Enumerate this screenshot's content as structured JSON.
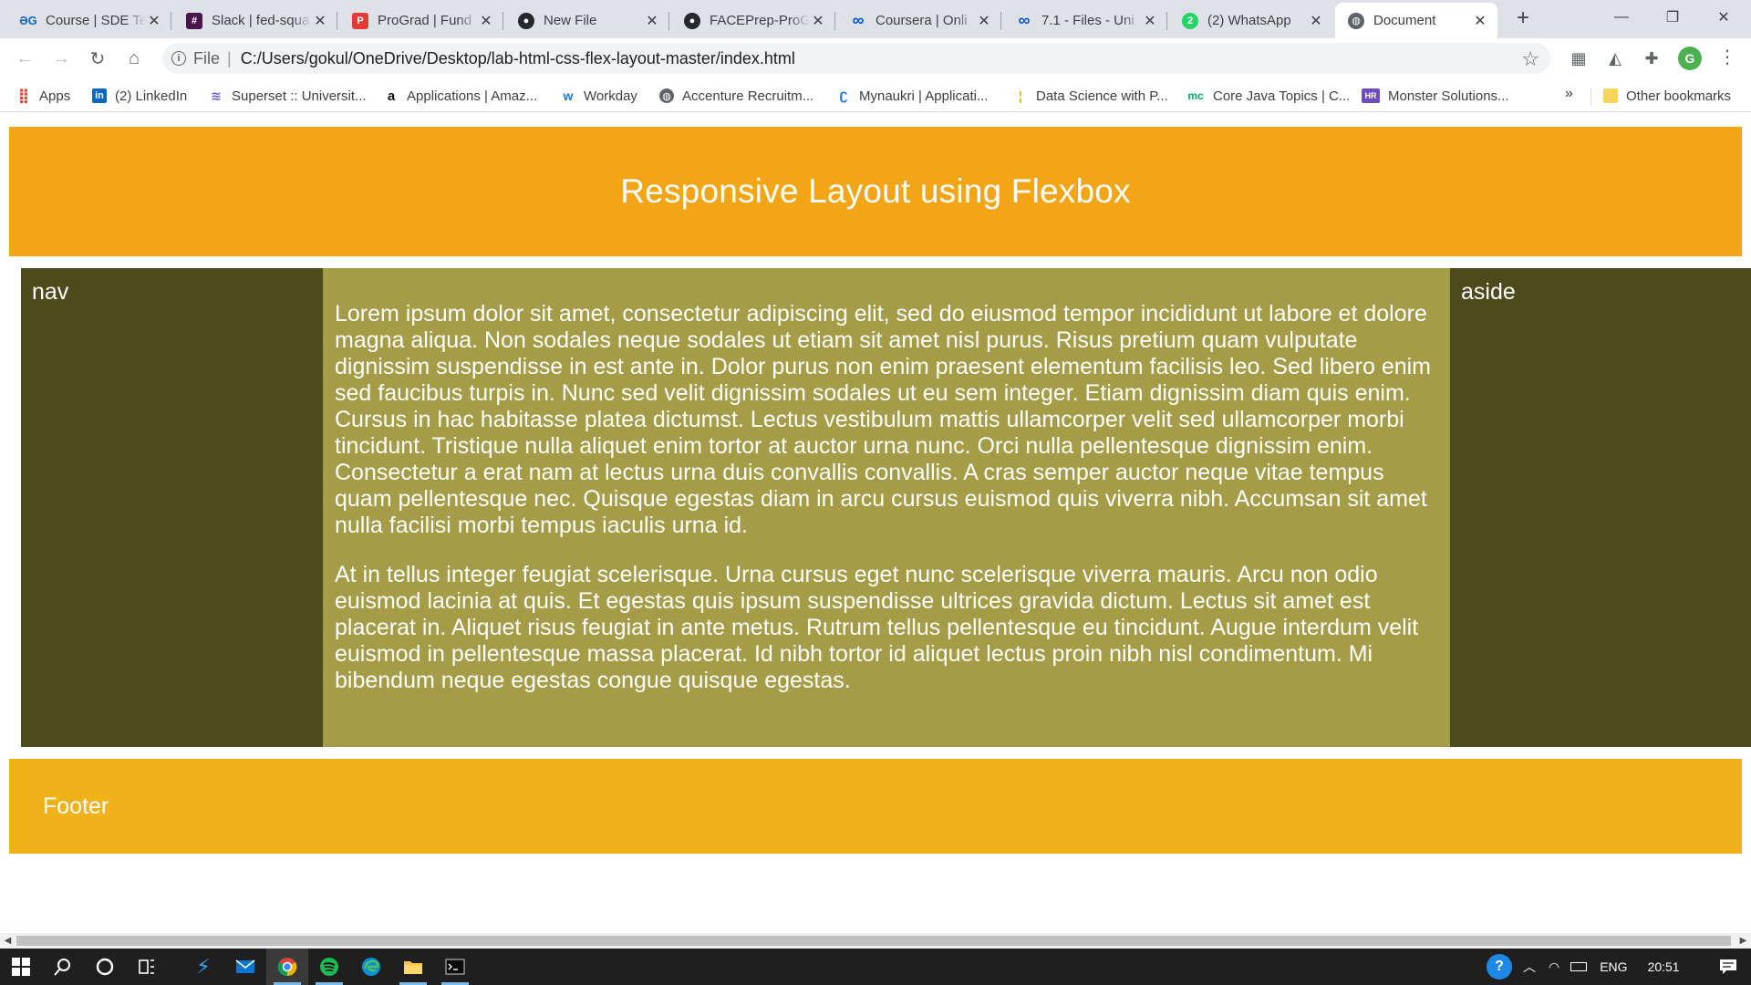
{
  "browser": {
    "tabs": [
      {
        "title": "Course | SDE Te",
        "favicon": "grad-logo-icon",
        "color": "#1565c0",
        "glyph": "ƏG"
      },
      {
        "title": "Slack | fed-squa",
        "favicon": "slack-icon",
        "color": "#4a154b",
        "glyph": "#"
      },
      {
        "title": "ProGrad | Fund",
        "favicon": "prograd-icon",
        "color": "#e53935",
        "glyph": "P"
      },
      {
        "title": "New File",
        "favicon": "github-icon",
        "color": "#24292e",
        "glyph": "●"
      },
      {
        "title": "FACEPrep-ProG",
        "favicon": "github-icon",
        "color": "#24292e",
        "glyph": "●"
      },
      {
        "title": "Coursera | Onli",
        "favicon": "coursera-icon",
        "color": "#0056d2",
        "glyph": "∞"
      },
      {
        "title": "7.1 - Files - Uni",
        "favicon": "coursera-icon",
        "color": "#0056d2",
        "glyph": "∞"
      },
      {
        "title": "(2) WhatsApp",
        "favicon": "whatsapp-icon",
        "color": "#25d366",
        "glyph": "2"
      },
      {
        "title": "Document",
        "favicon": "globe-icon",
        "color": "#5f6368",
        "glyph": "◍",
        "active": true
      }
    ],
    "address": {
      "scheme": "File",
      "url": "C:/Users/gokul/OneDrive/Desktop/lab-html-css-flex-layout-master/index.html"
    },
    "profile_initial": "G",
    "bookmarks": [
      {
        "label": "Apps",
        "icon": "apps-grid-icon",
        "color": "#ea4335"
      },
      {
        "label": "(2) LinkedIn",
        "icon": "linkedin-icon",
        "color": "#0a66c2"
      },
      {
        "label": "Superset :: Universit...",
        "icon": "superset-icon",
        "color": "#6f5bd3"
      },
      {
        "label": "Applications | Amaz...",
        "icon": "amazon-icon",
        "color": "#111111"
      },
      {
        "label": "Workday",
        "icon": "workday-icon",
        "color": "#f5a623"
      },
      {
        "label": "Accenture Recruitm...",
        "icon": "globe-icon",
        "color": "#5f6368"
      },
      {
        "label": "Mynaukri | Applicati...",
        "icon": "naukri-icon",
        "color": "#1a73e8"
      },
      {
        "label": "Data Science with P...",
        "icon": "datascience-icon",
        "color": "#f4b400"
      },
      {
        "label": "Core Java Topics | C...",
        "icon": "mc-icon",
        "color": "#00a86b"
      },
      {
        "label": "Monster Solutions...",
        "icon": "monster-icon",
        "color": "#6e4cbf"
      }
    ],
    "bookmarks_more": "»",
    "other_bookmarks": "Other bookmarks"
  },
  "page": {
    "header_title": "Responsive Layout using Flexbox",
    "nav_label": "nav",
    "aside_label": "aside",
    "main_paragraphs": [
      "Lorem ipsum dolor sit amet, consectetur adipiscing elit, sed do eiusmod tempor incididunt ut labore et dolore magna aliqua. Non sodales neque sodales ut etiam sit amet nisl purus. Risus pretium quam vulputate dignissim suspendisse in est ante in. Dolor purus non enim praesent elementum facilisis leo. Sed libero enim sed faucibus turpis in. Nunc sed velit dignissim sodales ut eu sem integer. Etiam dignissim diam quis enim. Cursus in hac habitasse platea dictumst. Lectus vestibulum mattis ullamcorper velit sed ullamcorper morbi tincidunt. Tristique nulla aliquet enim tortor at auctor urna nunc. Orci nulla pellentesque dignissim enim. Consectetur a erat nam at lectus urna duis convallis convallis. A cras semper auctor neque vitae tempus quam pellentesque nec. Quisque egestas diam in arcu cursus euismod quis viverra nibh. Accumsan sit amet nulla facilisi morbi tempus iaculis urna id.",
      "At in tellus integer feugiat scelerisque. Urna cursus eget nunc scelerisque viverra mauris. Arcu non odio euismod lacinia at quis. Et egestas quis ipsum suspendisse ultrices gravida dictum. Lectus sit amet est placerat in. Aliquet risus feugiat in ante metus. Rutrum tellus pellentesque eu tincidunt. Augue interdum velit euismod in pellentesque massa placerat. Id nibh tortor id aliquet lectus proin nibh nisl condimentum. Mi bibendum neque egestas congue quisque egestas."
    ],
    "footer_label": "Footer",
    "colors": {
      "header": "#f2a516",
      "nav": "#4d4a1b",
      "main": "#a49c46",
      "aside": "#4d4a1b",
      "footer": "#efb21a"
    }
  },
  "taskbar": {
    "icons": [
      "windows-start-icon",
      "search-icon",
      "cortana-icon",
      "task-view-icon",
      "vscode-icon",
      "mail-icon",
      "chrome-icon",
      "spotify-icon",
      "edge-icon",
      "file-explorer-icon",
      "terminal-icon"
    ],
    "language": "ENG",
    "time": "20:51"
  }
}
